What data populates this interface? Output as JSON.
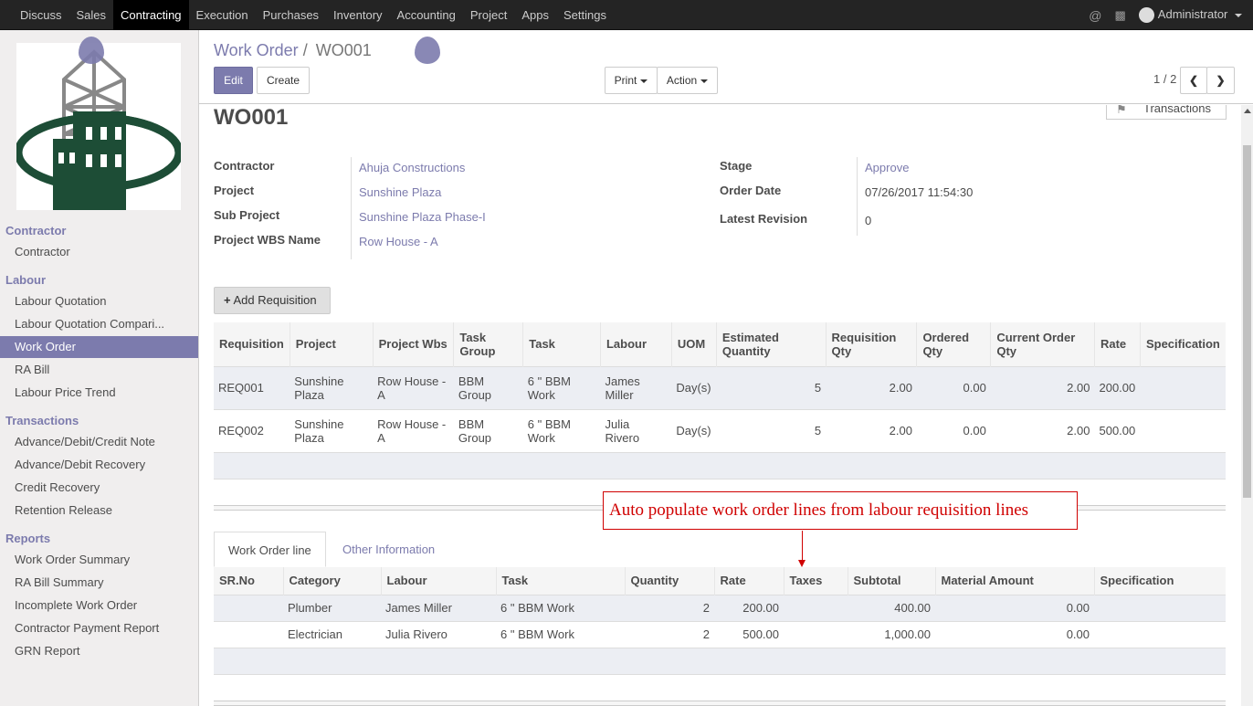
{
  "topbar": {
    "menu": [
      "Discuss",
      "Sales",
      "Contracting",
      "Execution",
      "Purchases",
      "Inventory",
      "Accounting",
      "Project",
      "Apps",
      "Settings"
    ],
    "user": "Administrator"
  },
  "sidebar": {
    "sections": [
      {
        "title": "Contractor",
        "items": [
          "Contractor"
        ]
      },
      {
        "title": "Labour",
        "items": [
          "Labour Quotation",
          "Labour Quotation Compari...",
          "Work Order",
          "RA Bill",
          "Labour Price Trend"
        ]
      },
      {
        "title": "Transactions",
        "items": [
          "Advance/Debit/Credit Note",
          "Advance/Debit Recovery",
          "Credit Recovery",
          "Retention Release"
        ]
      },
      {
        "title": "Reports",
        "items": [
          "Work Order Summary",
          "RA Bill Summary",
          "Incomplete Work Order",
          "Contractor Payment Report",
          "GRN Report"
        ]
      }
    ],
    "active_item": "Work Order"
  },
  "control_panel": {
    "breadcrumb_parent": "Work Order",
    "breadcrumb_sep": "/",
    "breadcrumb_current": "WO001",
    "edit": "Edit",
    "create": "Create",
    "print": "Print",
    "action": "Action",
    "pager": "1 / 2"
  },
  "form": {
    "title": "WO001",
    "transactions_button": "Transactions",
    "left_fields": [
      {
        "label": "Contractor",
        "value": "Ahuja Constructions"
      },
      {
        "label": "Project",
        "value": "Sunshine Plaza"
      },
      {
        "label": "Sub Project",
        "value": "Sunshine Plaza Phase-I"
      },
      {
        "label": "Project WBS Name",
        "value": "Row House - A"
      }
    ],
    "right_fields": [
      {
        "label": "Stage",
        "value": "Approve"
      },
      {
        "label": "Order Date",
        "value": "07/26/2017 11:54:30"
      },
      {
        "label": "Latest Revision",
        "value": "0"
      }
    ],
    "add_requisition": "Add Requisition"
  },
  "requisition_table": {
    "headers": [
      "Requisition",
      "Project",
      "Project Wbs",
      "Task Group",
      "Task",
      "Labour",
      "UOM",
      "Estimated Quantity",
      "Requisition Qty",
      "Ordered Qty",
      "Current Order Qty",
      "Rate",
      "Specification"
    ],
    "rows": [
      [
        "REQ001",
        "Sunshine Plaza",
        "Row House - A",
        "BBM Group",
        "6 \" BBM Work",
        "James Miller",
        "Day(s)",
        "5",
        "2.00",
        "0.00",
        "2.00",
        "200.00",
        ""
      ],
      [
        "REQ002",
        "Sunshine Plaza",
        "Row House - A",
        "BBM Group",
        "6 \" BBM Work",
        "Julia Rivero",
        "Day(s)",
        "5",
        "2.00",
        "0.00",
        "2.00",
        "500.00",
        ""
      ]
    ]
  },
  "annotation": "Auto populate work order lines from labour requisition lines",
  "tabs": [
    "Work Order line",
    "Other Information"
  ],
  "work_order_lines": {
    "headers": [
      "SR.No",
      "Category",
      "Labour",
      "Task",
      "Quantity",
      "Rate",
      "Taxes",
      "Subtotal",
      "Material Amount",
      "Specification"
    ],
    "rows": [
      [
        "",
        "Plumber",
        "James Miller",
        "6 \" BBM Work",
        "2",
        "200.00",
        "",
        "400.00",
        "0.00",
        ""
      ],
      [
        "",
        "Electrician",
        "Julia Rivero",
        "6 \" BBM Work",
        "2",
        "500.00",
        "",
        "1,000.00",
        "0.00",
        ""
      ]
    ]
  },
  "colors": {
    "accent": "#7c7bad",
    "topbar": "#242424",
    "annotation": "#d00000"
  }
}
